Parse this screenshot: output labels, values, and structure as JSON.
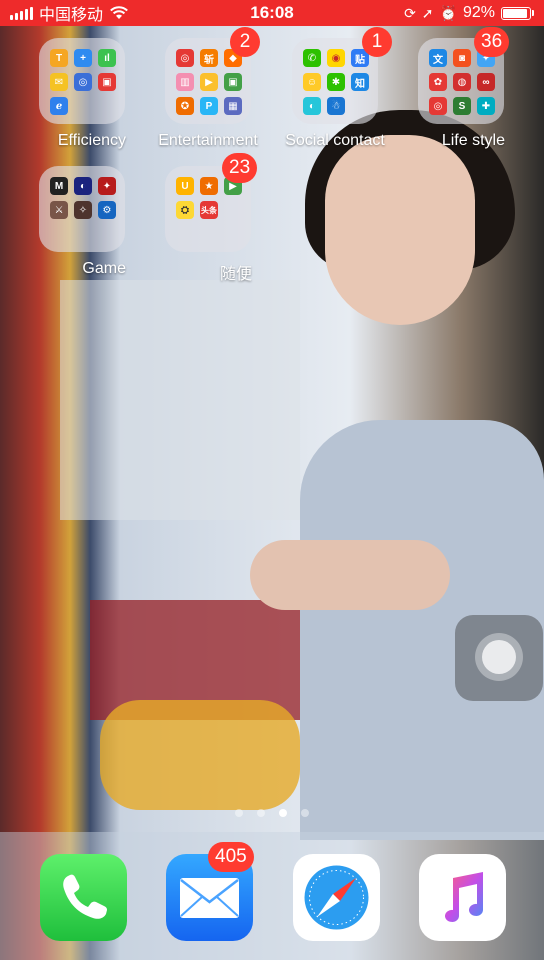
{
  "status_bar": {
    "carrier": "中国移动",
    "time": "16:08",
    "battery_percent": "92%",
    "battery_level": 0.92,
    "icons": [
      "signal-icon",
      "wifi-icon",
      "rotation-lock-icon",
      "location-icon",
      "alarm-icon",
      "battery-icon"
    ]
  },
  "folders": [
    {
      "label": "Efficiency",
      "badge": ""
    },
    {
      "label": "Entertainment",
      "badge": "2"
    },
    {
      "label": "Social contact",
      "badge": "1"
    },
    {
      "label": "Life style",
      "badge": "36"
    },
    {
      "label": "Game",
      "badge": ""
    },
    {
      "label": "随便",
      "badge": "23"
    }
  ],
  "mini_icons": {
    "folder_0": [
      "T",
      "+",
      "ıl",
      "✉",
      "◎",
      "▣",
      "ℯ",
      "",
      ""
    ],
    "folder_2": [
      "✆",
      "◉",
      "贴",
      "☺",
      "✱",
      "知",
      "◐",
      "☃",
      ""
    ],
    "folder_3": [
      "文",
      "◙",
      "✦",
      "✿",
      "◍",
      "∞",
      "◎",
      "S",
      "✚"
    ],
    "folder_5": [
      "U",
      "★",
      "▶",
      "⛭",
      "头条",
      "",
      "",
      "",
      ""
    ]
  },
  "page_dots": {
    "count": 4,
    "active_index": 2
  },
  "dock": [
    {
      "app": "Phone",
      "badge": ""
    },
    {
      "app": "Mail",
      "badge": "405"
    },
    {
      "app": "Safari",
      "badge": ""
    },
    {
      "app": "Music",
      "badge": ""
    }
  ],
  "colors": {
    "status_bar_bg": "#ee2b2b",
    "badge_red": "#ff3b30",
    "folder_bg": "rgba(225,225,230,0.62)"
  }
}
